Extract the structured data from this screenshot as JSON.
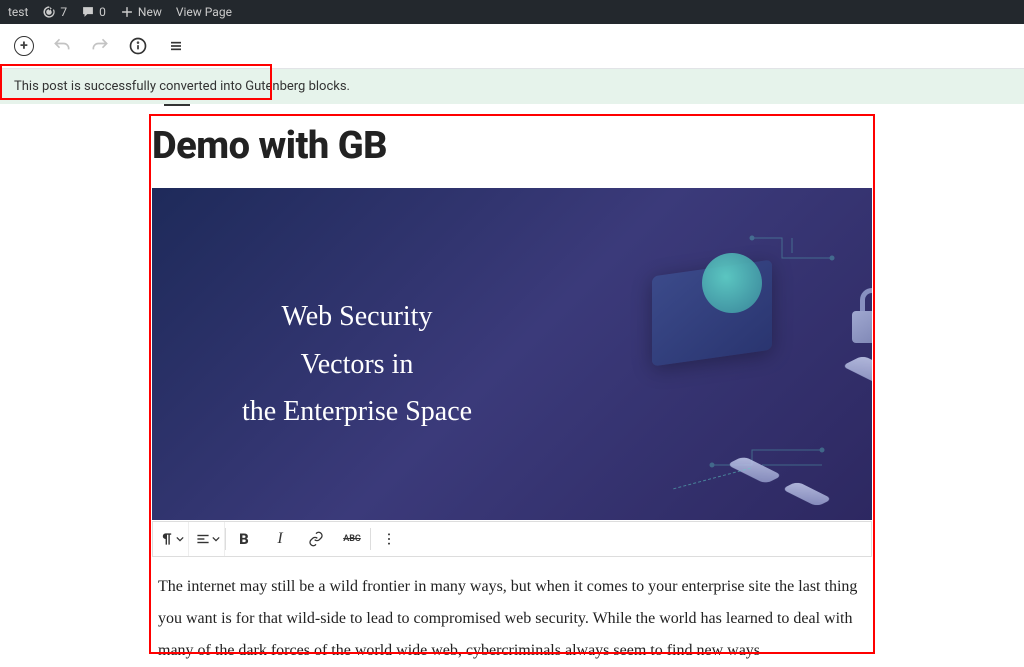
{
  "admin_bar": {
    "site_name": "test",
    "updates_count": "7",
    "comments_count": "0",
    "new_label": "New",
    "view_page_label": "View Page"
  },
  "notice": {
    "message": "This post is successfully converted into Gutenberg blocks."
  },
  "post": {
    "title": "Demo with GB",
    "image_text_line1": "Web Security",
    "image_text_line2": "Vectors in",
    "image_text_line3": "the Enterprise Space",
    "paragraph": "The internet may still be a wild frontier in many ways, but when it comes to your enterprise site the last thing you want is for that wild-side to lead to compromised web security. While the world has learned to deal with many of the dark forces of the world wide web, cybercriminals always seem to find new ways"
  },
  "block_toolbar": {
    "strike_label": "ABC"
  }
}
